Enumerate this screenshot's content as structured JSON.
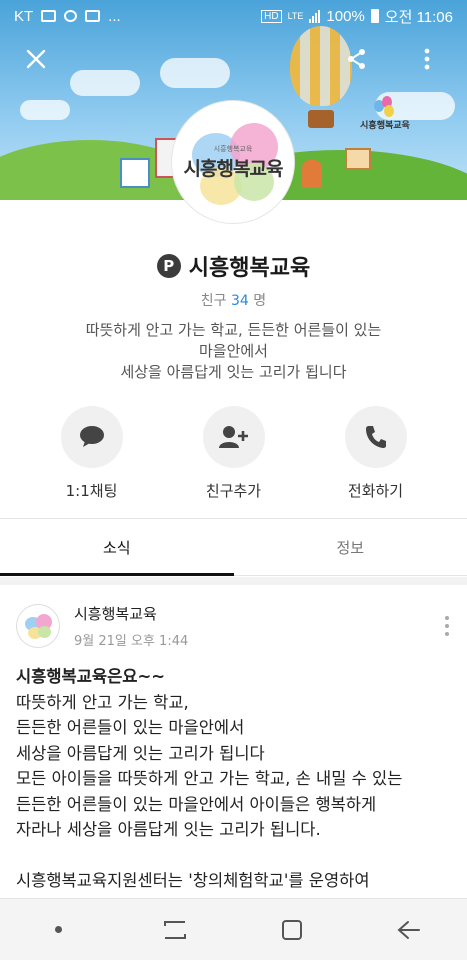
{
  "statusbar": {
    "carrier": "KT",
    "notif_ellipsis": "...",
    "hd": "HD",
    "lte": "LTE",
    "battery": "100%",
    "time": "오전 11:06"
  },
  "topbar": {
    "close_icon": "close-icon",
    "share_icon": "share-icon",
    "more_icon": "more-vertical-icon"
  },
  "banner": {
    "small_logo_top": "시흥행복교육",
    "small_logo_sub": "시흥행복교육"
  },
  "logo": {
    "text": "시흥행복교육",
    "subtext": "시흥행복교육"
  },
  "profile": {
    "name": "시흥행복교육",
    "friends_label": "친구",
    "friends_count": "34",
    "friends_unit": "명",
    "description_line1": "따뜻하게 안고 가는 학교, 든든한 어른들이 있는",
    "description_line2": "마을안에서",
    "description_line3": "세상을 아름답게 잇는 고리가 됩니다"
  },
  "actions": [
    {
      "label": "1:1채팅",
      "icon": "chat-bubble-icon"
    },
    {
      "label": "친구추가",
      "icon": "add-friend-icon"
    },
    {
      "label": "전화하기",
      "icon": "phone-icon"
    }
  ],
  "tabs": [
    {
      "label": "소식",
      "active": true
    },
    {
      "label": "정보",
      "active": false
    }
  ],
  "post": {
    "author": "시흥행복교육",
    "time": "9월 21일 오후 1:44",
    "title": "시흥행복교육은요~~",
    "lines": [
      "따뜻하게 안고 가는 학교,",
      "든든한 어른들이 있는 마을안에서",
      "세상을 아름답게 잇는 고리가 됩니다",
      "모든 아이들을 따뜻하게 안고 가는 학교, 손 내밀 수 있는",
      "든든한 어른들이 있는 마을안에서 아이들은 행복하게",
      "자라나 세상을 아름답게 잇는 고리가 됩니다."
    ],
    "last_line": "시흥행복교육지원센터는 '창의체험학교'를 운영하여"
  },
  "navbar": {
    "dot": "home-dot-icon",
    "recents": "recents-icon",
    "home": "home-square-icon",
    "back": "back-arrow-icon"
  },
  "colors": {
    "accent_blue": "#2a8ad8",
    "sky": "#4aa3d9",
    "grass": "#6dbb3a"
  }
}
